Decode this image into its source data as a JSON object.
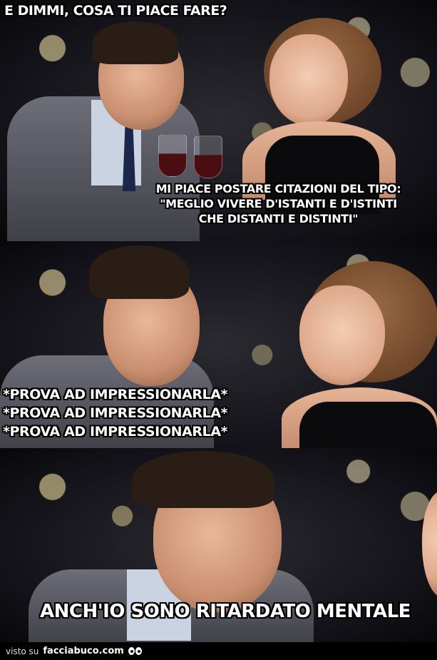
{
  "panels": [
    {
      "question": "E DIMMI, COSA TI PIACE FARE?",
      "reply_lines": [
        "MI PIACE POSTARE CITAZIONI DEL TIPO:",
        "\"MEGLIO VIVERE D'ISTANTI E D'ISTINTI",
        "CHE DISTANTI E DISTINTI\""
      ]
    },
    {
      "thought_lines": [
        "*PROVA AD IMPRESSIONARLA*",
        "*PROVA AD IMPRESSIONARLA*",
        "*PROVA AD IMPRESSIONARLA*"
      ]
    },
    {
      "caption": "ANCH'IO SONO RITARDATO MENTALE"
    }
  ],
  "footer": {
    "prefix": "visto su",
    "site": "facciabuco.com"
  }
}
